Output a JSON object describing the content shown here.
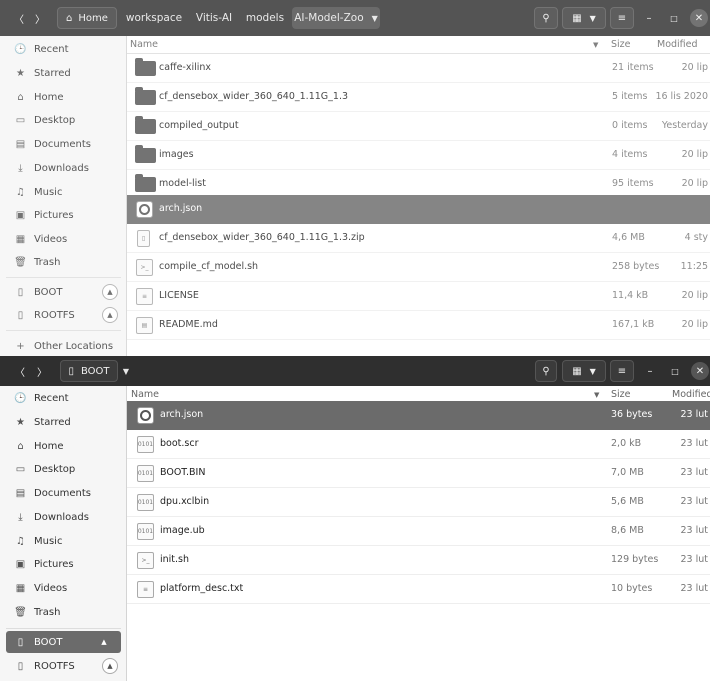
{
  "win1": {
    "nav": {
      "back": "〈",
      "forward": "〉",
      "home_label": "Home"
    },
    "breadcrumbs": [
      "workspace",
      "Vitis-AI",
      "models",
      "AI-Model-Zoo"
    ],
    "columns": {
      "name": "Name",
      "size": "Size",
      "modified": "Modified"
    },
    "sidebar": [
      {
        "label": "Recent",
        "icon": "🕒"
      },
      {
        "label": "Starred",
        "icon": "★"
      },
      {
        "label": "Home",
        "icon": "⌂"
      },
      {
        "label": "Desktop",
        "icon": "▭"
      },
      {
        "label": "Documents",
        "icon": "▤"
      },
      {
        "label": "Downloads",
        "icon": "⤓"
      },
      {
        "label": "Music",
        "icon": "♫"
      },
      {
        "label": "Pictures",
        "icon": "▣"
      },
      {
        "label": "Videos",
        "icon": "▦"
      },
      {
        "label": "Trash",
        "icon": "🗑"
      },
      {
        "label": "BOOT",
        "icon": "▯"
      },
      {
        "label": "ROOTFS",
        "icon": "▯"
      },
      {
        "label": "Other Locations",
        "icon": "+"
      }
    ],
    "files": [
      {
        "name": "caffe-xilinx",
        "size": "21 items",
        "modified": "20 lip",
        "type": "folder"
      },
      {
        "name": "cf_densebox_wider_360_640_1.11G_1.3",
        "size": "5 items",
        "modified": "16 lis 2020",
        "type": "folder"
      },
      {
        "name": "compiled_output",
        "size": "0 items",
        "modified": "Yesterday",
        "type": "folder"
      },
      {
        "name": "images",
        "size": "4 items",
        "modified": "20 lip",
        "type": "folder"
      },
      {
        "name": "model-list",
        "size": "95 items",
        "modified": "20 lip",
        "type": "folder"
      },
      {
        "name": "arch.json",
        "size": "",
        "modified": "",
        "type": "json"
      },
      {
        "name": "cf_densebox_wider_360_640_1.11G_1.3.zip",
        "size": "4,6 MB",
        "modified": "4 sty",
        "type": "zip"
      },
      {
        "name": "compile_cf_model.sh",
        "size": "258 bytes",
        "modified": "11:25",
        "type": "script"
      },
      {
        "name": "LICENSE",
        "size": "11,4 kB",
        "modified": "20 lip",
        "type": "text"
      },
      {
        "name": "README.md",
        "size": "167,1 kB",
        "modified": "20 lip",
        "type": "markdown"
      }
    ]
  },
  "win2": {
    "nav": {
      "back": "〈",
      "forward": "〉",
      "location_label": "BOOT"
    },
    "columns": {
      "name": "Name",
      "size": "Size",
      "modified": "Modified"
    },
    "sidebar": [
      {
        "label": "Recent",
        "icon": "🕒"
      },
      {
        "label": "Starred",
        "icon": "★"
      },
      {
        "label": "Home",
        "icon": "⌂"
      },
      {
        "label": "Desktop",
        "icon": "▭"
      },
      {
        "label": "Documents",
        "icon": "▤"
      },
      {
        "label": "Downloads",
        "icon": "⤓"
      },
      {
        "label": "Music",
        "icon": "♫"
      },
      {
        "label": "Pictures",
        "icon": "▣"
      },
      {
        "label": "Videos",
        "icon": "▦"
      },
      {
        "label": "Trash",
        "icon": "🗑"
      },
      {
        "label": "BOOT",
        "icon": "▯"
      },
      {
        "label": "ROOTFS",
        "icon": "▯"
      }
    ],
    "files": [
      {
        "name": "arch.json",
        "size": "36 bytes",
        "modified": "23 lut",
        "type": "json"
      },
      {
        "name": "boot.scr",
        "size": "2,0 kB",
        "modified": "23 lut",
        "type": "binary"
      },
      {
        "name": "BOOT.BIN",
        "size": "7,0 MB",
        "modified": "23 lut",
        "type": "binary"
      },
      {
        "name": "dpu.xclbin",
        "size": "5,6 MB",
        "modified": "23 lut",
        "type": "binary"
      },
      {
        "name": "image.ub",
        "size": "8,6 MB",
        "modified": "23 lut",
        "type": "binary"
      },
      {
        "name": "init.sh",
        "size": "129 bytes",
        "modified": "23 lut",
        "type": "script"
      },
      {
        "name": "platform_desc.txt",
        "size": "10 bytes",
        "modified": "23 lut",
        "type": "text"
      }
    ]
  }
}
